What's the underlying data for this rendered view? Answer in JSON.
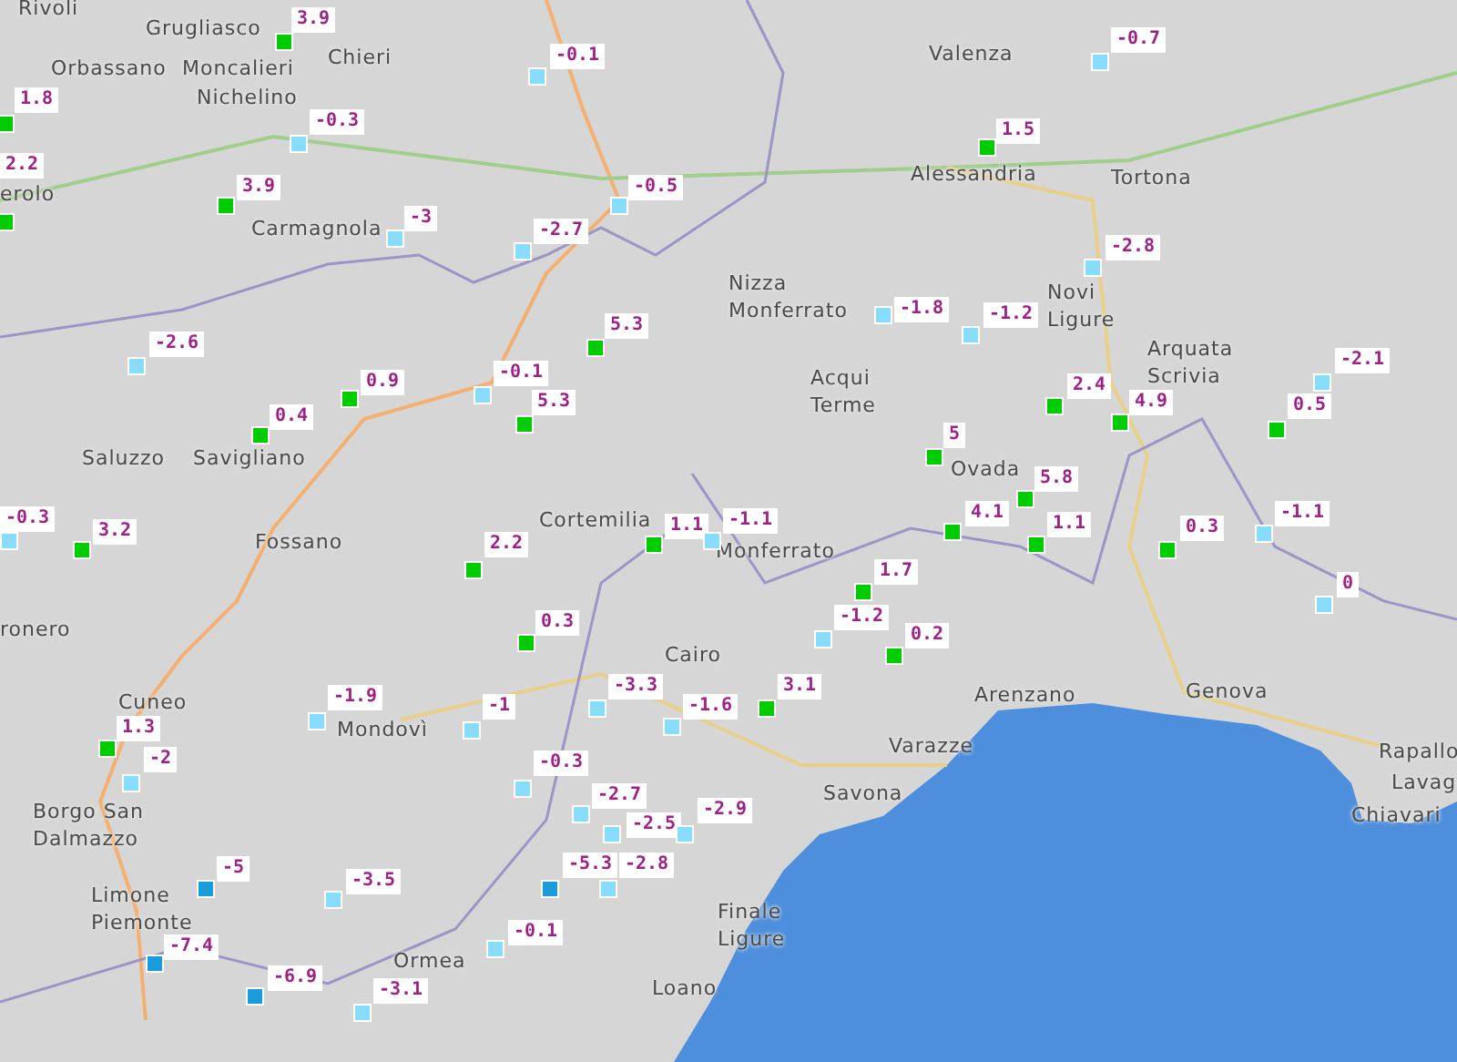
{
  "map": {
    "towns": [
      {
        "lines": [
          "Rivoli"
        ]
      },
      {
        "lines": [
          "Grugliasco"
        ]
      },
      {
        "lines": [
          "Valenza"
        ]
      },
      {
        "lines": [
          "Chieri"
        ]
      },
      {
        "lines": [
          "Orbassano"
        ]
      },
      {
        "lines": [
          "Moncalieri"
        ]
      },
      {
        "lines": [
          "Nichelino"
        ]
      },
      {
        "lines": [
          "Alessandria"
        ]
      },
      {
        "lines": [
          "Tortona"
        ]
      },
      {
        "lines": [
          "erolo"
        ]
      },
      {
        "lines": [
          "Carmagnola"
        ]
      },
      {
        "lines": [
          "Nizza",
          "Monferrato"
        ]
      },
      {
        "lines": [
          "Novi",
          "Ligure"
        ]
      },
      {
        "lines": [
          "Arquata",
          "Scrivia"
        ]
      },
      {
        "lines": [
          "Acqui",
          "Terme"
        ]
      },
      {
        "lines": [
          "Saluzzo"
        ]
      },
      {
        "lines": [
          "Savigliano"
        ]
      },
      {
        "lines": [
          "Ovada"
        ]
      },
      {
        "lines": [
          "Cortemilia"
        ]
      },
      {
        "lines": [
          "Fossano"
        ]
      },
      {
        "lines": [
          "Monferrato"
        ]
      },
      {
        "lines": [
          "ronero"
        ]
      },
      {
        "lines": [
          "Cairo"
        ]
      },
      {
        "lines": [
          "Genova"
        ]
      },
      {
        "lines": [
          "Arenzano"
        ]
      },
      {
        "lines": [
          "Cuneo"
        ]
      },
      {
        "lines": [
          "Mondovì"
        ]
      },
      {
        "lines": [
          "Varazze"
        ]
      },
      {
        "lines": [
          "Rapallo"
        ]
      },
      {
        "lines": [
          "Lavag"
        ]
      },
      {
        "lines": [
          "Savona"
        ]
      },
      {
        "lines": [
          "Borgo San",
          "Dalmazzo"
        ]
      },
      {
        "lines": [
          "Chiavari"
        ]
      },
      {
        "lines": [
          "Limone",
          "Piemonte"
        ]
      },
      {
        "lines": [
          "Finale",
          "Ligure"
        ]
      },
      {
        "lines": [
          "Ormea"
        ]
      },
      {
        "lines": [
          "Loano"
        ]
      }
    ],
    "stations": [
      {
        "value": "3.9",
        "color": "#00cc00"
      },
      {
        "value": "1.8",
        "color": "#00cc00"
      },
      {
        "value": "2.2",
        "color": "#00cc00"
      },
      {
        "value": "-0.3",
        "color": "#88ddff"
      },
      {
        "value": "3.9",
        "color": "#00cc00"
      },
      {
        "value": "-3",
        "color": "#88ddff"
      },
      {
        "value": "-2.6",
        "color": "#88ddff"
      },
      {
        "value": "0.9",
        "color": "#00cc00"
      },
      {
        "value": "0.4",
        "color": "#00cc00"
      },
      {
        "value": "-0.3",
        "color": "#88ddff"
      },
      {
        "value": "3.2",
        "color": "#00cc00"
      },
      {
        "value": "-0.1",
        "color": "#88ddff"
      },
      {
        "value": "-0.5",
        "color": "#88ddff"
      },
      {
        "value": "-2.7",
        "color": "#88ddff"
      },
      {
        "value": "5.3",
        "color": "#00cc00"
      },
      {
        "value": "-0.1",
        "color": "#88ddff"
      },
      {
        "value": "5.3",
        "color": "#00cc00"
      },
      {
        "value": "-1.8",
        "color": "#88ddff"
      },
      {
        "value": "-1.2",
        "color": "#88ddff"
      },
      {
        "value": "5",
        "color": "#00cc00"
      },
      {
        "value": "-0.7",
        "color": "#88ddff"
      },
      {
        "value": "1.5",
        "color": "#00cc00"
      },
      {
        "value": "-2.8",
        "color": "#88ddff"
      },
      {
        "value": "2.4",
        "color": "#00cc00"
      },
      {
        "value": "4.9",
        "color": "#00cc00"
      },
      {
        "value": "-2.1",
        "color": "#88ddff"
      },
      {
        "value": "0.5",
        "color": "#00cc00"
      },
      {
        "value": "4.1",
        "color": "#00cc00"
      },
      {
        "value": "5.8",
        "color": "#00cc00"
      },
      {
        "value": "1.1",
        "color": "#00cc00"
      },
      {
        "value": "0.3",
        "color": "#00cc00"
      },
      {
        "value": "-1.1",
        "color": "#88ddff"
      },
      {
        "value": "0",
        "color": "#88ddff"
      },
      {
        "value": "1.1",
        "color": "#00cc00"
      },
      {
        "value": "-1.1",
        "color": "#88ddff"
      },
      {
        "value": "2.2",
        "color": "#00cc00"
      },
      {
        "value": "0.3",
        "color": "#00cc00"
      },
      {
        "value": "1.7",
        "color": "#00cc00"
      },
      {
        "value": "-1.2",
        "color": "#88ddff"
      },
      {
        "value": "0.2",
        "color": "#00cc00"
      },
      {
        "value": "-3.3",
        "color": "#88ddff"
      },
      {
        "value": "-1.6",
        "color": "#88ddff"
      },
      {
        "value": "3.1",
        "color": "#00cc00"
      },
      {
        "value": "-1",
        "color": "#88ddff"
      },
      {
        "value": "-0.3",
        "color": "#88ddff"
      },
      {
        "value": "-2.7",
        "color": "#88ddff"
      },
      {
        "value": "-2.5",
        "color": "#88ddff"
      },
      {
        "value": "-2.9",
        "color": "#88ddff"
      },
      {
        "value": "-5.3",
        "color": "#1a9bdc"
      },
      {
        "value": "-2.8",
        "color": "#88ddff"
      },
      {
        "value": "-0.1",
        "color": "#88ddff"
      },
      {
        "value": "-1.9",
        "color": "#88ddff"
      },
      {
        "value": "1.3",
        "color": "#00cc00"
      },
      {
        "value": "-2",
        "color": "#88ddff"
      },
      {
        "value": "-5",
        "color": "#1a9bdc"
      },
      {
        "value": "-3.5",
        "color": "#88ddff"
      },
      {
        "value": "-7.4",
        "color": "#1a9bdc"
      },
      {
        "value": "-6.9",
        "color": "#1a9bdc"
      },
      {
        "value": "-3.1",
        "color": "#88ddff"
      }
    ]
  }
}
